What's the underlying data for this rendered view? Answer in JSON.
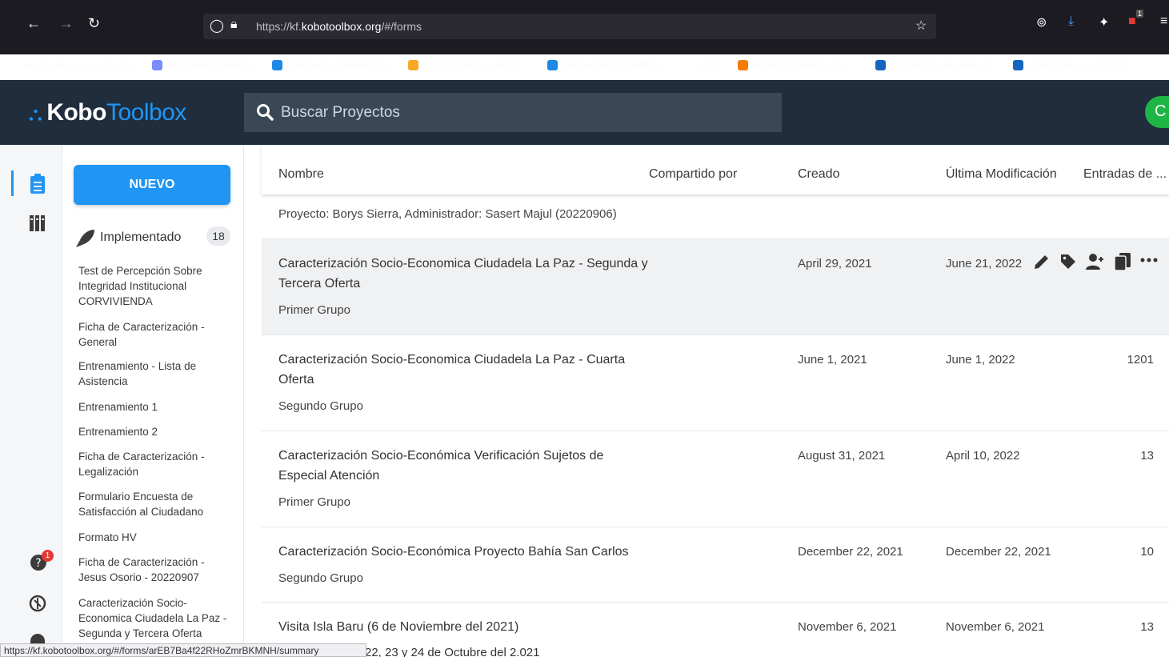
{
  "browser": {
    "url_prefix": "https://kf.",
    "url_domain": "kobotoolbox.org",
    "url_suffix": "/#/forms",
    "bookmarks": [
      "Importar marcadores...",
      "Animated Drawings",
      "Campus | OpenBootca...",
      "Comenzando - Let's E...",
      "Formación de Fullstac...",
      "Inicio",
      "Portal miplanilla.com ...",
      "Conviértete en data an...",
      "Conviértete en desarro..."
    ],
    "extension_badge": "1",
    "status_link": "https://kf.kobotoolbox.org/#/forms/arEB7Ba4f22RHoZmrBKMNH/summary"
  },
  "header": {
    "logo_kobo": "Kobo",
    "logo_toolbox": "Toolbox",
    "search_placeholder": "Buscar Proyectos",
    "avatar_letter": "C"
  },
  "rail": {
    "notification_count": "1"
  },
  "sidebar": {
    "new_label": "NUEVO",
    "deployed_label": "Implementado",
    "deployed_count": "18",
    "projects": [
      "Test de Percepción Sobre Integridad Institucional CORVIVIENDA",
      "Ficha de Caracterización - General",
      "Entrenamiento - Lista de Asistencia",
      "Entrenamiento 1",
      "Entrenamiento 2",
      "Ficha de Caracterización - Legalización",
      "Formulario Encuesta de Satisfacción al Ciudadano",
      "Formato HV",
      "Ficha de Caracterización - Jesus Osorio - 20220907",
      "Caracterización Socio-Economica Ciudadela La Paz - Segunda y Tercera Oferta"
    ]
  },
  "table": {
    "headers": {
      "name": "Nombre",
      "shared_by": "Compartido por",
      "created": "Creado",
      "modified": "Última Modificación",
      "submissions": "Entradas de ..."
    },
    "rows": [
      {
        "name_line1": "Proyecto: Borys Sierra, Administrador: Sasert Majul (20220906)",
        "name_line2": "",
        "owner": "",
        "created": "",
        "modified": "",
        "submissions": ""
      },
      {
        "name_line1": "Caracterización Socio-Economica Ciudadela La Paz - Segunda y",
        "name_line2": "Tercera Oferta",
        "owner": "Primer Grupo",
        "created": "April 29, 2021",
        "modified": "June 21, 2022",
        "submissions": ""
      },
      {
        "name_line1": "Caracterización Socio-Economica Ciudadela La Paz - Cuarta",
        "name_line2": "Oferta",
        "owner": "Segundo Grupo",
        "created": "June 1, 2021",
        "modified": "June 1, 2022",
        "submissions": "1201"
      },
      {
        "name_line1": "Caracterización Socio-Económica Verificación Sujetos de",
        "name_line2": "Especial Atención",
        "owner": "Primer Grupo",
        "created": "August 31, 2021",
        "modified": "April 10, 2022",
        "submissions": "13"
      },
      {
        "name_line1": "Caracterización Socio-Económica Proyecto Bahía San Carlos",
        "name_line2": "",
        "owner": "Segundo Grupo",
        "created": "December 22, 2021",
        "modified": "December 22, 2021",
        "submissions": "10"
      },
      {
        "name_line1": "Visita Isla Baru (6 de Noviembre del 2021)",
        "name_line2": "",
        "owner": "",
        "created": "November 6, 2021",
        "modified": "November 6, 2021",
        "submissions": "13"
      }
    ],
    "partial_row_text": "22, 23 y 24 de Octubre del 2.021"
  },
  "colors": {
    "accent": "#2095f3",
    "header_bg": "#1f2d3d",
    "avatar": "#1db543",
    "badge_red": "#e53935"
  }
}
